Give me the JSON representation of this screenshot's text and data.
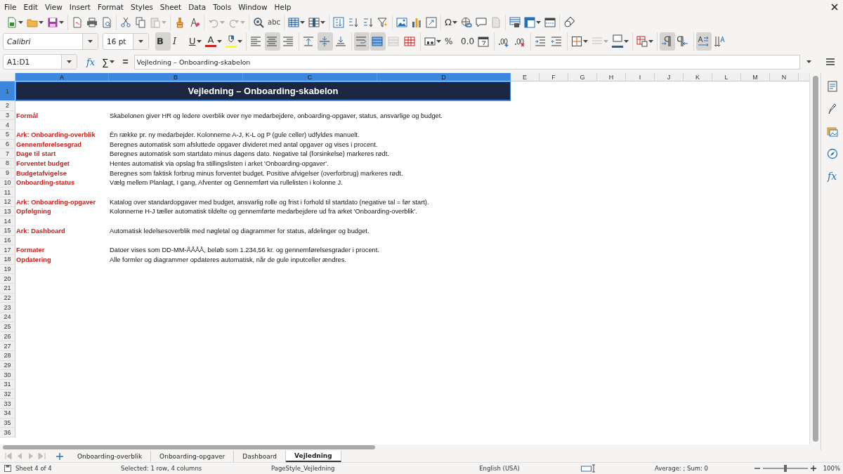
{
  "menu": [
    "File",
    "Edit",
    "View",
    "Insert",
    "Format",
    "Styles",
    "Sheet",
    "Data",
    "Tools",
    "Window",
    "Help"
  ],
  "toolbar1": {
    "groups": [
      [
        {
          "kind": "new",
          "dropdown": true,
          "disabled": false
        },
        {
          "kind": "open",
          "dropdown": true,
          "disabled": false
        },
        {
          "kind": "save",
          "dropdown": true,
          "disabled": false
        }
      ],
      [
        {
          "kind": "pdf",
          "dropdown": false,
          "disabled": false
        },
        {
          "kind": "print",
          "dropdown": false,
          "disabled": false
        },
        {
          "kind": "preview",
          "dropdown": false,
          "disabled": false
        }
      ],
      [
        {
          "kind": "cut",
          "dropdown": false,
          "disabled": false
        },
        {
          "kind": "copy",
          "dropdown": false,
          "disabled": false
        },
        {
          "kind": "paste",
          "dropdown": true,
          "disabled": true
        }
      ],
      [
        {
          "kind": "clone",
          "dropdown": false,
          "disabled": false
        },
        {
          "kind": "clear",
          "dropdown": false,
          "disabled": false
        }
      ],
      [
        {
          "kind": "undo",
          "dropdown": true,
          "disabled": true
        },
        {
          "kind": "redo",
          "dropdown": true,
          "disabled": true
        }
      ],
      [
        {
          "kind": "find",
          "dropdown": false,
          "disabled": false
        },
        {
          "kind": "spelling",
          "glyph": "abc",
          "dropdown": false,
          "disabled": false
        }
      ],
      [
        {
          "kind": "rows",
          "dropdown": true,
          "disabled": false
        },
        {
          "kind": "columns",
          "dropdown": true,
          "disabled": false
        }
      ],
      [
        {
          "kind": "sort",
          "dropdown": false,
          "disabled": false
        },
        {
          "kind": "sortasc",
          "dropdown": false,
          "disabled": false
        },
        {
          "kind": "sortdesc",
          "dropdown": false,
          "disabled": false
        },
        {
          "kind": "filter",
          "dropdown": false,
          "disabled": false
        }
      ],
      [
        {
          "kind": "image",
          "dropdown": false,
          "disabled": false
        },
        {
          "kind": "chart",
          "dropdown": false,
          "disabled": false
        },
        {
          "kind": "pivot",
          "dropdown": false,
          "disabled": false
        }
      ],
      [
        {
          "kind": "special",
          "glyph": "Ω",
          "dropdown": true,
          "disabled": false
        },
        {
          "kind": "hyperlink",
          "dropdown": false,
          "disabled": false
        },
        {
          "kind": "comment",
          "dropdown": false,
          "disabled": false
        },
        {
          "kind": "headerfooter",
          "dropdown": false,
          "disabled": true
        }
      ],
      [
        {
          "kind": "printarea",
          "dropdown": false,
          "disabled": false
        },
        {
          "kind": "freeze",
          "dropdown": true,
          "disabled": false
        },
        {
          "kind": "split",
          "dropdown": false,
          "disabled": false
        }
      ],
      [
        {
          "kind": "shapes",
          "dropdown": false,
          "disabled": false
        }
      ]
    ]
  },
  "font_name": "Calibri",
  "font_size": "16 pt",
  "toolbar2": {
    "groups": [
      [
        {
          "kind": "bold",
          "glyph": "B",
          "dropdown": false,
          "pressed": true,
          "disabled": false
        },
        {
          "kind": "italic",
          "glyph": "I",
          "dropdown": false,
          "pressed": false,
          "disabled": false
        },
        {
          "kind": "underline",
          "glyph": "U",
          "dropdown": true,
          "pressed": false,
          "disabled": false
        },
        {
          "kind": "fontcolor",
          "glyph": "A",
          "color": "#c9211e",
          "dropdown": true,
          "pressed": false,
          "disabled": false
        },
        {
          "kind": "highlight",
          "color": "#ffff00",
          "dropdown": true,
          "pressed": false,
          "disabled": false
        }
      ],
      [
        {
          "kind": "alignleft",
          "dropdown": false,
          "pressed": false,
          "disabled": false
        },
        {
          "kind": "aligncenter",
          "dropdown": false,
          "pressed": true,
          "disabled": false
        },
        {
          "kind": "alignright",
          "dropdown": false,
          "pressed": false,
          "disabled": false
        }
      ],
      [
        {
          "kind": "aligntop",
          "dropdown": false,
          "pressed": false,
          "disabled": false
        },
        {
          "kind": "alignmiddle",
          "dropdown": false,
          "pressed": true,
          "disabled": false
        },
        {
          "kind": "alignbottom",
          "dropdown": false,
          "pressed": false,
          "disabled": false
        }
      ],
      [
        {
          "kind": "wrap",
          "dropdown": false,
          "pressed": true,
          "disabled": false
        },
        {
          "kind": "mergecenter",
          "dropdown": false,
          "pressed": true,
          "disabled": false
        },
        {
          "kind": "merge",
          "dropdown": false,
          "pressed": false,
          "disabled": true
        },
        {
          "kind": "unmerge",
          "dropdown": false,
          "pressed": false,
          "disabled": false
        }
      ],
      [
        {
          "kind": "currency",
          "dropdown": true,
          "pressed": false,
          "disabled": false
        },
        {
          "kind": "percent",
          "glyph": "%",
          "dropdown": false,
          "pressed": false,
          "disabled": false
        },
        {
          "kind": "number",
          "glyph": "0.0",
          "dropdown": false,
          "pressed": false,
          "disabled": false
        },
        {
          "kind": "date",
          "dropdown": false,
          "pressed": false,
          "disabled": false
        }
      ],
      [
        {
          "kind": "adddecimal",
          "dropdown": false,
          "pressed": false,
          "disabled": false
        },
        {
          "kind": "deldecimal",
          "dropdown": false,
          "pressed": false,
          "disabled": false
        }
      ],
      [
        {
          "kind": "indentinc",
          "dropdown": false,
          "pressed": false,
          "disabled": false
        },
        {
          "kind": "indentdec",
          "dropdown": false,
          "pressed": false,
          "disabled": false
        }
      ],
      [
        {
          "kind": "borders",
          "dropdown": true,
          "pressed": false,
          "disabled": false
        },
        {
          "kind": "borderstyle",
          "dropdown": true,
          "pressed": false,
          "disabled": true
        },
        {
          "kind": "bordercolor",
          "color": "#2a6099",
          "dropdown": true,
          "pressed": false,
          "disabled": false
        }
      ],
      [
        {
          "kind": "conditional",
          "dropdown": true,
          "pressed": false,
          "disabled": false
        }
      ],
      [
        {
          "kind": "ltr",
          "dropdown": false,
          "pressed": true,
          "disabled": false
        },
        {
          "kind": "rtl",
          "dropdown": false,
          "pressed": false,
          "disabled": false
        }
      ],
      [
        {
          "kind": "horizontal",
          "dropdown": false,
          "pressed": true,
          "disabled": false
        },
        {
          "kind": "stacked",
          "dropdown": false,
          "pressed": false,
          "disabled": false
        }
      ]
    ]
  },
  "formula_bar": {
    "name_box": "A1:D1",
    "function_wizard": "fx",
    "sum": "∑",
    "equals": "=",
    "content": "Vejledning – Onboarding-skabelon"
  },
  "columns": [
    {
      "label": "A",
      "selected": true
    },
    {
      "label": "B",
      "selected": true
    },
    {
      "label": "C",
      "selected": true
    },
    {
      "label": "D",
      "selected": true
    },
    {
      "label": "E",
      "selected": false
    },
    {
      "label": "F",
      "selected": false
    },
    {
      "label": "G",
      "selected": false
    },
    {
      "label": "H",
      "selected": false
    },
    {
      "label": "I",
      "selected": false
    },
    {
      "label": "J",
      "selected": false
    },
    {
      "label": "K",
      "selected": false
    },
    {
      "label": "L",
      "selected": false
    },
    {
      "label": "M",
      "selected": false
    },
    {
      "label": "N",
      "selected": false
    }
  ],
  "rows": [
    {
      "number": "1",
      "selected": true,
      "title": "Vejledning – Onboarding-skabelon"
    },
    {
      "number": "2",
      "selected": false
    },
    {
      "number": "3",
      "selected": false,
      "label": "Formål",
      "text": "Skabelonen giver HR og ledere overblik over nye medarbejdere, onboarding-opgaver, status, ansvarlige og budget."
    },
    {
      "number": "4",
      "selected": false
    },
    {
      "number": "5",
      "selected": false,
      "label": "Ark: Onboarding-overblik",
      "text": "Én række pr. ny medarbejder. Kolonnerne A-J, K-L og P (gule celler) udfyldes manuelt."
    },
    {
      "number": "6",
      "selected": false,
      "label": "Gennemførelsesgrad",
      "text": "Beregnes automatisk som afsluttede opgaver divideret med antal opgaver og vises i procent."
    },
    {
      "number": "7",
      "selected": false,
      "label": "Dage til start",
      "text": "Beregnes automatisk som startdato minus dagens dato. Negative tal (forsinkelse) markeres rødt."
    },
    {
      "number": "8",
      "selected": false,
      "label": "Forventet budget",
      "text": "Hentes automatisk via opslag fra stillingslisten i arket 'Onboarding-opgaver'."
    },
    {
      "number": "9",
      "selected": false,
      "label": "Budgetafvigelse",
      "text": "Beregnes som faktisk forbrug minus forventet budget. Positive afvigelser (overforbrug) markeres rødt."
    },
    {
      "number": "10",
      "selected": false,
      "label": "Onboarding-status",
      "text": "Vælg mellem Planlagt, I gang, Afventer og Gennemført via rullelisten i kolonne J."
    },
    {
      "number": "11",
      "selected": false
    },
    {
      "number": "12",
      "selected": false,
      "label": "Ark: Onboarding-opgaver",
      "text": "Katalog over standardopgaver med budget, ansvarlig rolle og frist i forhold til startdato (negative tal = før start)."
    },
    {
      "number": "13",
      "selected": false,
      "label": "Opfølgning",
      "text": "Kolonnerne H-J tæller automatisk tildelte og gennemførte medarbejdere ud fra arket 'Onboarding-overblik'."
    },
    {
      "number": "14",
      "selected": false
    },
    {
      "number": "15",
      "selected": false,
      "label": "Ark: Dashboard",
      "text": "Automatisk ledelsesoverblik med nøgletal og diagrammer for status, afdelinger og budget."
    },
    {
      "number": "16",
      "selected": false
    },
    {
      "number": "17",
      "selected": false,
      "label": "Formater",
      "text": "Datoer vises som DD-MM-ÅÅÅÅ, beløb som 1.234,56 kr. og gennemførelsesgrader i procent."
    },
    {
      "number": "18",
      "selected": false,
      "label": "Opdatering",
      "text": "Alle formler og diagrammer opdateres automatisk, når de gule inputceller ændres."
    },
    {
      "number": "19",
      "selected": false
    },
    {
      "number": "20",
      "selected": false
    },
    {
      "number": "21",
      "selected": false
    },
    {
      "number": "22",
      "selected": false
    },
    {
      "number": "23",
      "selected": false
    },
    {
      "number": "24",
      "selected": false
    },
    {
      "number": "25",
      "selected": false
    },
    {
      "number": "26",
      "selected": false
    },
    {
      "number": "27",
      "selected": false
    },
    {
      "number": "28",
      "selected": false
    },
    {
      "number": "29",
      "selected": false
    },
    {
      "number": "30",
      "selected": false
    },
    {
      "number": "31",
      "selected": false
    },
    {
      "number": "32",
      "selected": false
    },
    {
      "number": "33",
      "selected": false
    },
    {
      "number": "34",
      "selected": false
    },
    {
      "number": "35",
      "selected": false
    },
    {
      "number": "36",
      "selected": false
    }
  ],
  "sidebar": [
    {
      "kind": "properties"
    },
    {
      "kind": "styles"
    },
    {
      "kind": "gallery"
    },
    {
      "kind": "navigator"
    },
    {
      "kind": "functions",
      "glyph": "fx"
    }
  ],
  "sheet_tabs": [
    {
      "label": "Onboarding-overblik",
      "selected": false
    },
    {
      "label": "Onboarding-opgaver",
      "selected": false
    },
    {
      "label": "Dashboard",
      "selected": false
    },
    {
      "label": "Vejledning",
      "selected": true
    }
  ],
  "status_bar": {
    "sheet": "Sheet 4 of 4",
    "selection": "Selected: 1 row, 4 columns",
    "page_style": "PageStyle_Vejledning",
    "language": "English (USA)",
    "summary": "Average: ; Sum: 0",
    "zoom": {
      "level": 0.5,
      "reading": "100%"
    }
  }
}
